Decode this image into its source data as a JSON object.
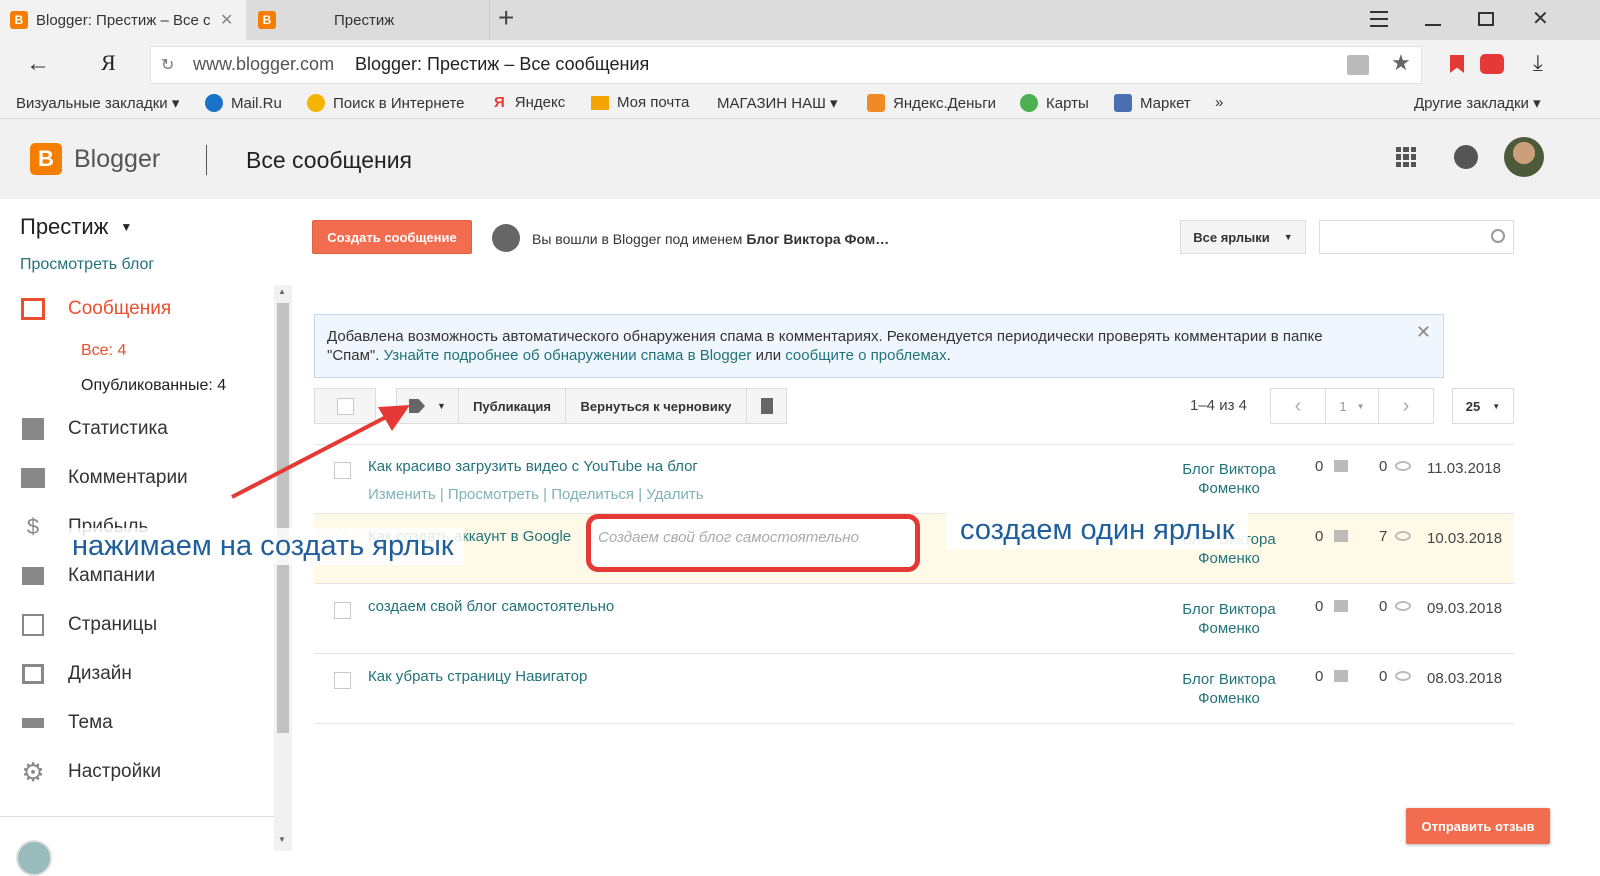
{
  "browser": {
    "tabs": [
      {
        "label": "Blogger: Престиж – Все с"
      },
      {
        "label": "Престиж"
      }
    ],
    "new_tab_glyph": "+",
    "url_domain": "www.blogger.com",
    "url_title": "Blogger: Престиж – Все сообщения",
    "bookmarks": [
      {
        "label": "Визуальные закладки ▾"
      },
      {
        "label": "Mail.Ru"
      },
      {
        "label": "Поиск в Интернете"
      },
      {
        "label": "Яндекс"
      },
      {
        "label": "Моя почта"
      },
      {
        "label": "МАГАЗИН НАШ ▾"
      },
      {
        "label": "Яндекс.Деньги"
      },
      {
        "label": "Карты"
      },
      {
        "label": "Маркет"
      },
      {
        "label": "»"
      },
      {
        "label": "Другие закладки ▾"
      }
    ]
  },
  "header": {
    "logo_text": "Blogger",
    "page_title": "Все сообщения"
  },
  "sidebar": {
    "blog_name": "Престиж",
    "view_blog": "Просмотреть блог",
    "posts_label": "Сообщения",
    "sub_all": "Все: 4",
    "sub_published": "Опубликованные: 4",
    "items": [
      {
        "label": "Статистика"
      },
      {
        "label": "Комментарии"
      },
      {
        "label": "Прибыль"
      },
      {
        "label": "Кампании"
      },
      {
        "label": "Страницы"
      },
      {
        "label": "Дизайн"
      },
      {
        "label": "Тема"
      },
      {
        "label": "Настройки"
      }
    ]
  },
  "toolbar": {
    "create_post": "Создать сообщение",
    "signed_in_prefix": "Вы вошли в Blogger под именем ",
    "signed_in_name": "Блог Виктора Фом…",
    "labels_dropdown": "Все ярлыки",
    "search_placeholder": ""
  },
  "notice": {
    "text1": "Добавлена возможность автоматического обнаружения спама в комментариях. Рекомендуется периодически проверять комментарии в папке",
    "text2": "\"Спам\". ",
    "link1": "Узнайте подробнее об обнаружении спама в Blogger",
    "text3": " или ",
    "link2": "сообщите о проблемах",
    "text4": "."
  },
  "actions": {
    "publish": "Публикация",
    "revert": "Вернуться к черновику",
    "range": "1–4 из 4",
    "page": "1",
    "per_page": "25"
  },
  "posts": [
    {
      "title": "Как красиво загрузить видео с YouTube на блог",
      "author": "Блог Виктора Фоменко",
      "comments": "0",
      "views": "0",
      "date": "11.03.2018",
      "row_actions": [
        "Изменить",
        "Просмотреть",
        "Поделиться",
        "Удалить"
      ]
    },
    {
      "title": "Как создать аккаунт в Google",
      "author": "Блог Виктора Фоменко",
      "comments": "0",
      "views": "7",
      "date": "10.03.2018",
      "label_input_placeholder": "Создаем свой блог самостоятельно"
    },
    {
      "title": "создаем свой блог самостоятельно",
      "author": "Блог Виктора Фоменко",
      "comments": "0",
      "views": "0",
      "date": "09.03.2018"
    },
    {
      "title": "Как убрать страницу Навигатор",
      "author": "Блог Виктора Фоменко",
      "comments": "0",
      "views": "0",
      "date": "08.03.2018"
    }
  ],
  "annotations": {
    "left_caption": "нажимаем на создать ярлык",
    "right_caption": "создаем один ярлык",
    "arrow_color": "#e53935",
    "highlight_color": "#e53935"
  },
  "feedback_button": "Отправить отзыв",
  "colors": {
    "brand_orange": "#f57d00",
    "create_button": "#f26c4f",
    "link_teal": "#22727a",
    "active_red": "#e9502f"
  }
}
